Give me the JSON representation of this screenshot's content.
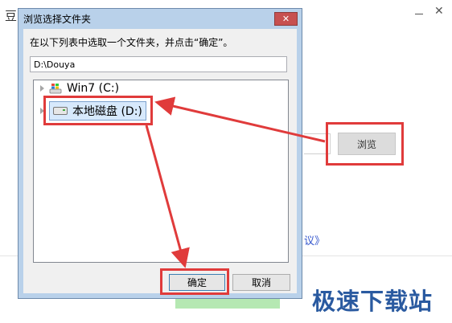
{
  "background_window": {
    "title_char": "豆",
    "close_symbol": "✕",
    "browse_label": "浏览",
    "agreement_text": "议》",
    "watermark": "极速下载站"
  },
  "dialog": {
    "title": "浏览选择文件夹",
    "close_symbol": "✕",
    "instruction": "在以下列表中选取一个文件夹，并点击“确定”。",
    "path_value": "D:\\Douya",
    "tree": [
      {
        "label": "Win7 (C:)",
        "icon": "windows-drive-icon",
        "selected": false
      },
      {
        "label": "本地磁盘 (D:)",
        "icon": "hard-drive-icon",
        "selected": true
      }
    ],
    "ok_label": "确定",
    "cancel_label": "取消"
  },
  "colors": {
    "annotation_red": "#e03b3b",
    "dialog_frame": "#b9d1ea",
    "close_red": "#c75050",
    "selection": "#d7e9fc",
    "watermark_blue": "#2a5aa0"
  }
}
